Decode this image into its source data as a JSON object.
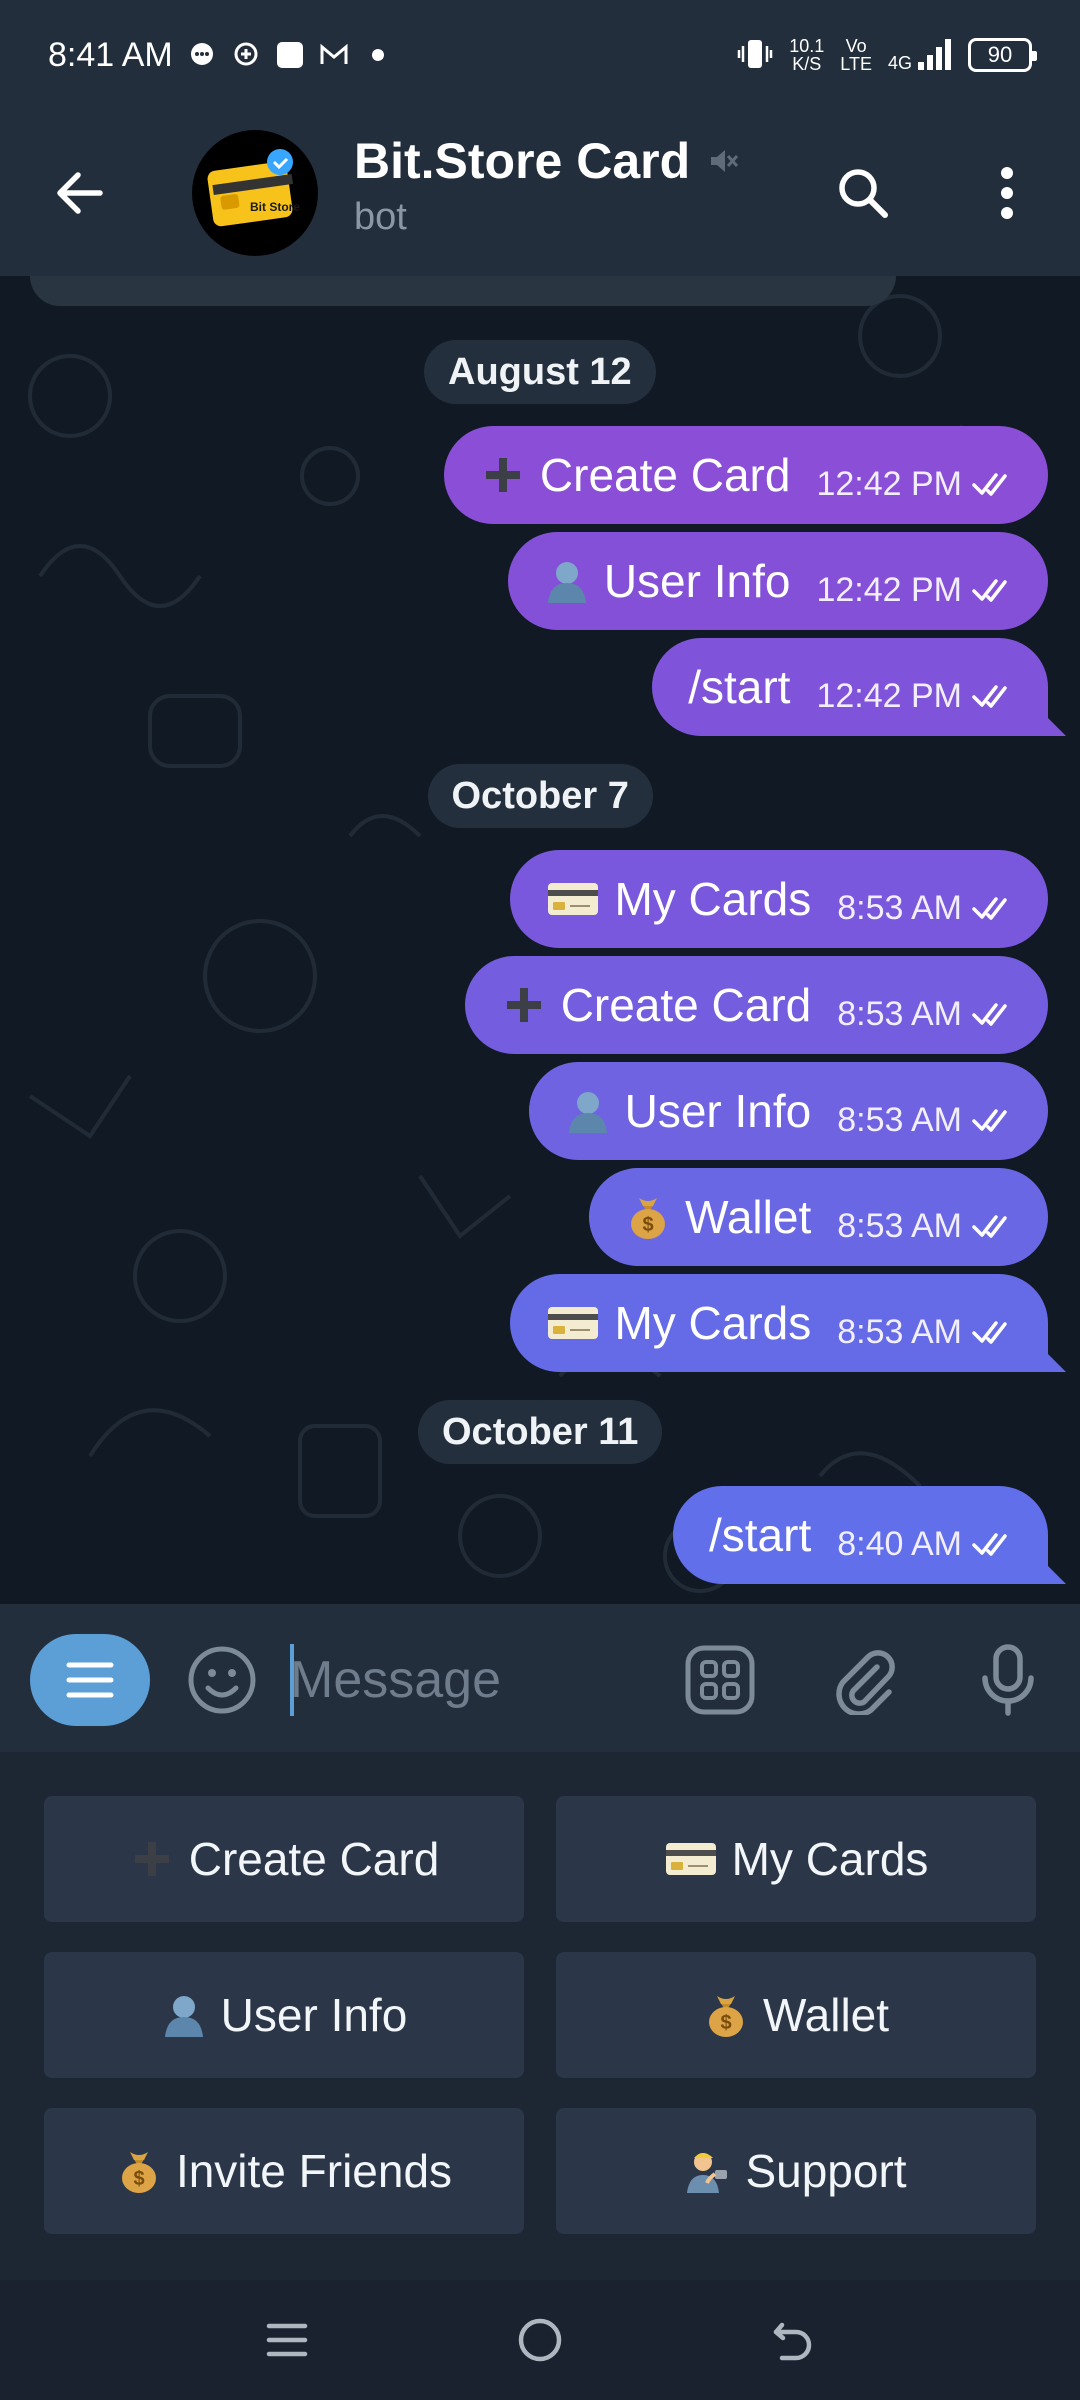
{
  "status_bar": {
    "time": "8:41 AM",
    "speed_value": "10.1",
    "speed_unit": "K/S",
    "volte_top": "Vo",
    "volte_bottom": "LTE",
    "network": "4G",
    "battery": "90",
    "icons": [
      "chat-bubble-icon",
      "location-icon",
      "app-icon",
      "gmail-icon",
      "dot-icon",
      "vibrate-icon",
      "signal-icon"
    ]
  },
  "header": {
    "title": "Bit.Store Card",
    "subtitle": "bot",
    "avatar_text": "Bit Store",
    "muted": true,
    "icons": [
      "back-arrow-icon",
      "mute-icon",
      "search-icon",
      "more-vert-icon"
    ]
  },
  "chat": {
    "groups": [
      {
        "date": "August 12",
        "messages": [
          {
            "emoji": "plus",
            "text": "Create Card",
            "time": "12:42 PM"
          },
          {
            "emoji": "user",
            "text": "User Info",
            "time": "12:42 PM"
          },
          {
            "emoji": "",
            "text": "/start",
            "time": "12:42 PM"
          }
        ]
      },
      {
        "date": "October 7",
        "messages": [
          {
            "emoji": "card",
            "text": "My Cards",
            "time": "8:53 AM"
          },
          {
            "emoji": "plus",
            "text": "Create Card",
            "time": "8:53 AM"
          },
          {
            "emoji": "user",
            "text": "User Info",
            "time": "8:53 AM"
          },
          {
            "emoji": "moneybag",
            "text": "Wallet",
            "time": "8:53 AM"
          },
          {
            "emoji": "card",
            "text": "My Cards",
            "time": "8:53 AM"
          }
        ]
      },
      {
        "date": "October 11",
        "messages": [
          {
            "emoji": "",
            "text": "/start",
            "time": "8:40 AM"
          }
        ]
      }
    ],
    "bubble_colors": [
      "#8a4fd6",
      "#8550d8",
      "#7f54da",
      "#7a58dd",
      "#755ddf",
      "#6f63e2",
      "#6a67e5",
      "#656be7",
      "#6170ea"
    ]
  },
  "input_bar": {
    "placeholder": "Message",
    "icons": [
      "menu-icon",
      "emoji-icon",
      "sticker-grid-icon",
      "attach-icon",
      "mic-icon"
    ]
  },
  "keyboard": {
    "buttons": [
      {
        "emoji": "plus",
        "label": "Create Card"
      },
      {
        "emoji": "card",
        "label": "My Cards"
      },
      {
        "emoji": "user",
        "label": "User Info"
      },
      {
        "emoji": "moneybag",
        "label": "Wallet"
      },
      {
        "emoji": "moneybag",
        "label": "Invite Friends"
      },
      {
        "emoji": "support",
        "label": "Support"
      }
    ]
  },
  "nav_bar": {
    "icons": [
      "recents-icon",
      "home-icon",
      "back-icon"
    ]
  },
  "colors": {
    "header_bg": "#232e3c",
    "chat_bg": "#111a24",
    "accent": "#5c9fd6",
    "keyboard_btn": "#2b3748"
  }
}
